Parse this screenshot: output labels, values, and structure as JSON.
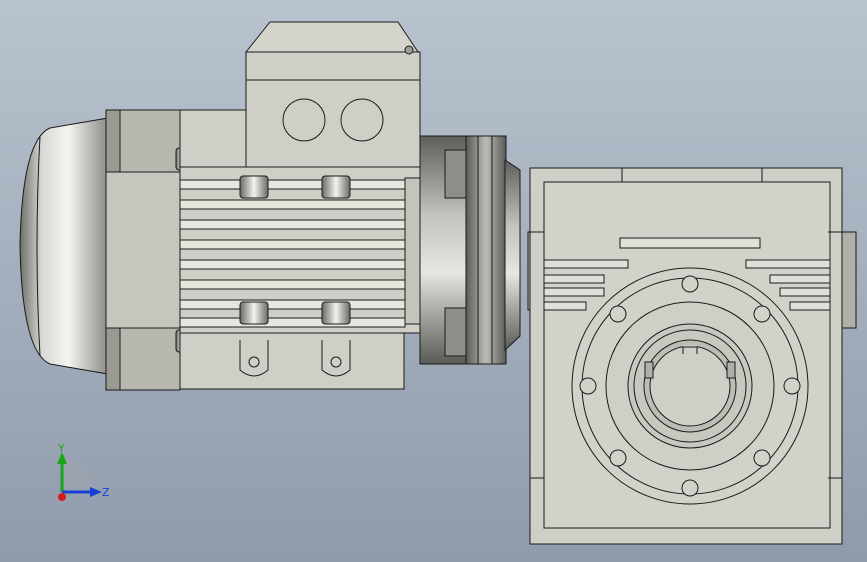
{
  "viewport": {
    "background_top": "#b9c3cf",
    "background_bottom": "#8f9bab"
  },
  "model": {
    "body_color": "#cfcfc7",
    "shade_color": "#9e9e96",
    "edge_color": "#1a1a1a",
    "metal_color": "#c8c8c8"
  },
  "triad": {
    "y_label": "Y",
    "z_label": "Z",
    "y_color": "#1aa61a",
    "z_color": "#1a3fd6",
    "x_color": "#d61a1a"
  }
}
